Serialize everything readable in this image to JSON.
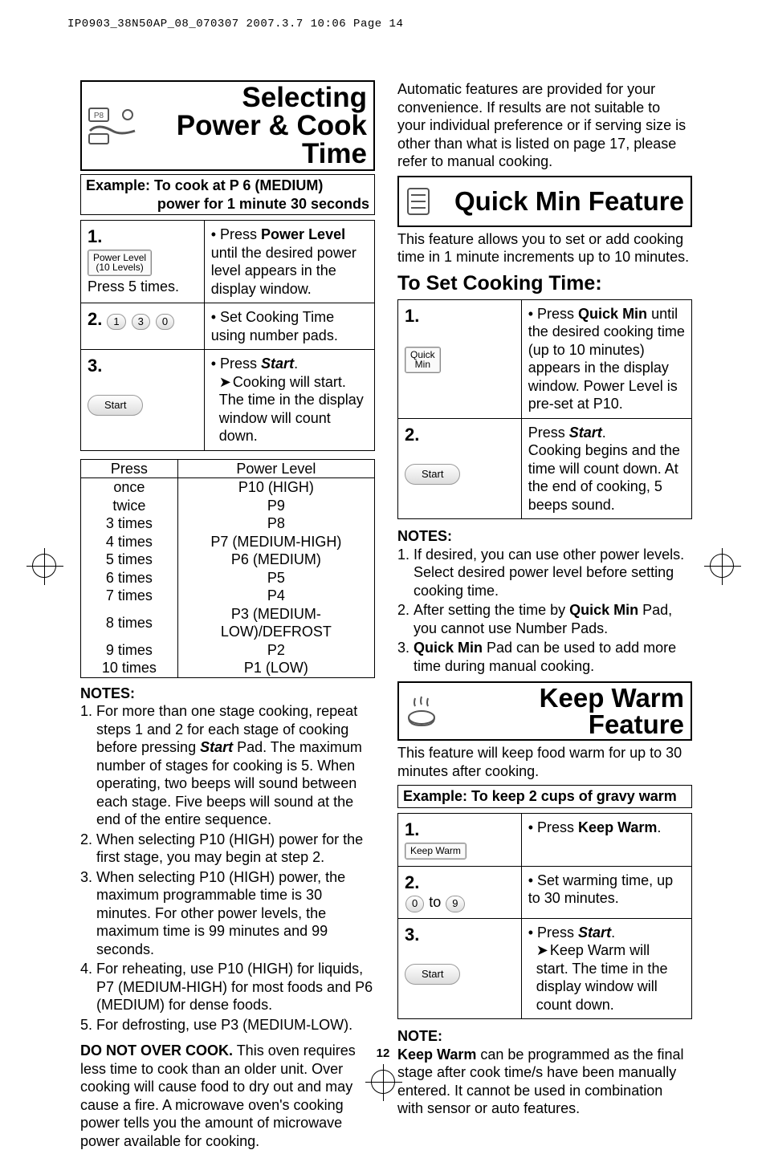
{
  "header_line": "IP0903_38N50AP_08_070307  2007.3.7  10:06  Page 14",
  "page_number": "12",
  "left": {
    "title": "Selecting Power & Cook Time",
    "example_line1": "Example: To cook at P 6 (MEDIUM)",
    "example_line2": "power for 1 minute 30 seconds",
    "steps": [
      {
        "num": "1.",
        "left_extra": "Press 5 times.",
        "pad": "Power Level\n(10 Levels)",
        "right": [
          "Press Power Level until the desired power level appears in the display window."
        ],
        "right_bold": "Power Level"
      },
      {
        "num": "2.",
        "keys": [
          "1",
          "3",
          "0"
        ],
        "right": [
          "Set Cooking Time using number pads."
        ]
      },
      {
        "num": "3.",
        "start": "Start",
        "right_main": "Press Start.",
        "right_bolditalic": "Start",
        "right_arrow": "Cooking will start. The time in the display window will count down."
      }
    ],
    "power_table": {
      "head": [
        "Press",
        "Power Level"
      ],
      "rows": [
        [
          "once",
          "P10 (HIGH)"
        ],
        [
          "twice",
          "P9"
        ],
        [
          "3 times",
          "P8"
        ],
        [
          "4 times",
          "P7 (MEDIUM-HIGH)"
        ],
        [
          "5 times",
          "P6 (MEDIUM)"
        ],
        [
          "6 times",
          "P5"
        ],
        [
          "7 times",
          "P4"
        ],
        [
          "8 times",
          "P3 (MEDIUM-LOW)/DEFROST"
        ],
        [
          "9 times",
          "P2"
        ],
        [
          "10 times",
          "P1 (LOW)"
        ]
      ]
    },
    "notes_label": "NOTES:",
    "notes": [
      "For more than one stage cooking, repeat steps 1 and 2 for each stage of cooking before pressing Start Pad. The maximum number of stages for cooking is 5. When operating, two beeps will sound between each stage. Five beeps will sound at the end of the entire sequence.",
      "When selecting P10 (HIGH) power for the first stage, you may begin at step 2.",
      "When selecting P10 (HIGH) power, the maximum programmable time is 30 minutes. For other power levels, the maximum time is 99 minutes and 99 seconds.",
      "For reheating, use P10 (HIGH) for liquids, P7 (MEDIUM-HIGH) for most foods and P6 (MEDIUM) for dense foods.",
      "For defrosting, use P3 (MEDIUM-LOW)."
    ],
    "overcook_bold": "DO NOT OVER COOK.",
    "overcook_rest": " This oven requires less time to cook than an older unit. Over cooking will cause food to dry out and may cause a fire. A microwave oven's cooking power tells you the amount of microwave power available for cooking."
  },
  "right": {
    "auto_intro": "Automatic features are provided for your convenience. If results are not suitable to your individual preference or if serving size is other than what is listed on page 17, please refer to manual cooking.",
    "quick": {
      "title": "Quick Min Feature",
      "intro": "This feature allows you to set or add cooking time in 1 minute increments up to 10 minutes.",
      "subhead": "To Set Cooking Time:",
      "steps": [
        {
          "num": "1.",
          "pad": "Quick\nMin",
          "right": "Press Quick Min until the desired cooking time (up to 10 minutes) appears in the display window. Power Level is pre-set at P10.",
          "right_bold": "Quick Min"
        },
        {
          "num": "2.",
          "start": "Start",
          "right_main": "Press Start.",
          "right_bolditalic": "Start",
          "right_rest": "Cooking begins and the time will count down. At the end of cooking, 5 beeps sound."
        }
      ],
      "notes_label": "NOTES:",
      "notes": [
        "If desired, you can use other power levels. Select desired power level before setting cooking time.",
        "After setting the time by Quick Min Pad, you cannot use Number Pads.",
        "Quick Min Pad can be used to add more time during manual cooking."
      ],
      "note2_bold": "Quick Min",
      "note3_bold": "Quick Min"
    },
    "keepwarm": {
      "title": "Keep Warm Feature",
      "intro": "This feature will keep food warm for up to 30 minutes after cooking.",
      "example": "Example: To keep 2 cups of gravy warm",
      "steps": [
        {
          "num": "1.",
          "pad": "Keep Warm",
          "right": "Press Keep Warm.",
          "right_bold": "Keep Warm"
        },
        {
          "num": "2.",
          "keys": [
            "0",
            "to",
            "9"
          ],
          "right": "Set warming time, up to 30 minutes."
        },
        {
          "num": "3.",
          "start": "Start",
          "right_main": "Press Start.",
          "right_bolditalic": "Start",
          "right_arrow": "Keep Warm will start. The time in the display window will count down."
        }
      ],
      "note_label": "NOTE:",
      "note_bold": "Keep Warm",
      "note_rest": " can be programmed as the final stage after cook time/s have been manually entered. It cannot be used in combination with sensor or auto features."
    }
  }
}
